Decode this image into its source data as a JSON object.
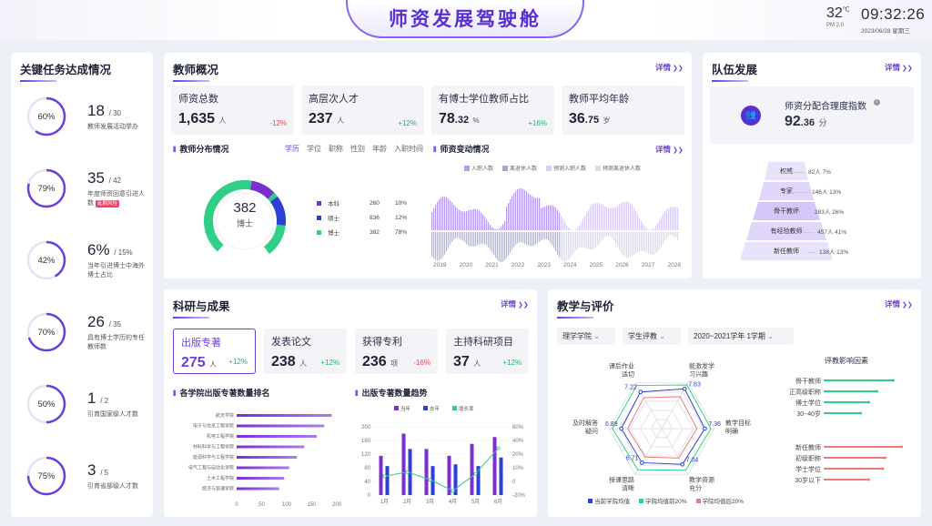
{
  "header": {
    "title": "师资发展驾驶舱",
    "temp": "32",
    "temp_unit": "℃",
    "pm": "PM 2.0",
    "time": "09:32:26",
    "date": "2023/06/28  星期三"
  },
  "left": {
    "title": "关键任务达成情况",
    "kpis": [
      {
        "pct": "60%",
        "pct_value": 0.6,
        "num": "18",
        "total": "/ 30",
        "desc": "教师发展活动举办",
        "badge": ""
      },
      {
        "pct": "79%",
        "pct_value": 0.79,
        "num": "35",
        "total": "/ 42",
        "desc": "年度师资回意引进人数",
        "badge": "延期风险"
      },
      {
        "pct": "42%",
        "pct_value": 0.42,
        "num": "6%",
        "total": "/ 15%",
        "desc": "当年引进博士中海外博士占比",
        "badge": ""
      },
      {
        "pct": "70%",
        "pct_value": 0.7,
        "num": "26",
        "total": "/ 35",
        "desc": "具有博士学历的专任教师数",
        "badge": ""
      },
      {
        "pct": "50%",
        "pct_value": 0.5,
        "num": "1",
        "total": "/ 2",
        "desc": "引育国家级人才数",
        "badge": ""
      },
      {
        "pct": "75%",
        "pct_value": 0.75,
        "num": "3",
        "total": "/ 5",
        "desc": "引育省部级人才数",
        "badge": ""
      }
    ]
  },
  "overview": {
    "title": "教师概况",
    "detail": "详情",
    "stats": [
      {
        "label": "师资总数",
        "value": "1,635",
        "small": "",
        "unit": "人",
        "change": "-12%",
        "dir": "down"
      },
      {
        "label": "高层次人才",
        "value": "237",
        "small": "",
        "unit": "人",
        "change": "+12%",
        "dir": "up"
      },
      {
        "label": "有博士学位教师占比",
        "value": "78",
        "small": ".32",
        "unit": "%",
        "change": "+16%",
        "dir": "up"
      },
      {
        "label": "教师平均年龄",
        "value": "36",
        "small": ".75",
        "unit": "岁",
        "change": "",
        "dir": ""
      }
    ],
    "dist": {
      "subtitle": "教师分布情况",
      "tabs": [
        "学历",
        "学位",
        "职称",
        "性别",
        "年龄",
        "入职时间"
      ],
      "center_value": "382",
      "center_label": "博士",
      "items": [
        {
          "name": "本科",
          "count": "260",
          "pct": "10%",
          "color": "#7b2fd0"
        },
        {
          "name": "硕士",
          "count": "836",
          "pct": "12%",
          "color": "#2e3fd6"
        },
        {
          "name": "博士",
          "count": "382",
          "pct": "78%",
          "color": "#2fcf86"
        }
      ]
    },
    "change": {
      "subtitle": "师资变动情况",
      "detail": "详情",
      "legend": [
        "入职人数",
        "离退休人数",
        "预测入职人数",
        "预测离退休人数"
      ],
      "years": [
        "2019",
        "2020",
        "2021",
        "2022",
        "2023",
        "2024",
        "2025",
        "2026",
        "2027",
        "2028"
      ]
    }
  },
  "team": {
    "title": "队伍发展",
    "detail": "详情",
    "index_label": "师资分配合理度指数",
    "index_value": "92",
    "index_small": ".36",
    "index_unit": "分",
    "levels": [
      {
        "name": "权威",
        "value": "82人  7%"
      },
      {
        "name": "专家",
        "value": "146人  13%"
      },
      {
        "name": "骨干教师",
        "value": "283人  26%"
      },
      {
        "name": "有经验教师",
        "value": "457人  41%"
      },
      {
        "name": "新任教师",
        "value": "138人  13%"
      }
    ]
  },
  "research": {
    "title": "科研与成果",
    "detail": "详情",
    "stats": [
      {
        "label": "出版专著",
        "value": "275",
        "unit": "人",
        "change": "+12%",
        "dir": "up"
      },
      {
        "label": "发表论文",
        "value": "238",
        "unit": "人",
        "change": "+12%",
        "dir": "up"
      },
      {
        "label": "获得专利",
        "value": "236",
        "unit": "项",
        "change": "-16%",
        "dir": "down"
      },
      {
        "label": "主持科研项目",
        "value": "37",
        "unit": "人",
        "change": "+12%",
        "dir": "up"
      }
    ],
    "rank_title": "各学院出版专著数量排名",
    "trend_title": "出版专著数量趋势"
  },
  "teaching": {
    "title": "教学与评价",
    "detail": "详情",
    "selects": [
      "理学学院",
      "学生评教",
      "2020~2021学年 1学期"
    ],
    "radar_labels": [
      "能激发学习兴趣",
      "教学目标明确",
      "教学资源充分",
      "授课思路清晰",
      "及时解答疑问",
      "课后作业适切"
    ],
    "factor_title": "评教影响因素",
    "pos_factors": [
      "骨干教师",
      "正高级职称",
      "博士学位",
      "30~40岁"
    ],
    "neg_factors": [
      "新任教师",
      "初级职称",
      "学士学位",
      "30岁以下"
    ],
    "legend": [
      "当前学院均值",
      "学院均值前20%",
      "学院均值后20%"
    ]
  },
  "chart_data": [
    {
      "type": "bar",
      "title": "各学院出版专著数量排名",
      "categories": [
        "航天学院",
        "电子与信息工程学院",
        "机电工程学院",
        "材料科学与工程学院",
        "能源科学与工程学院",
        "电气工程与自动化学院",
        "土木工程学院",
        "经济与管理学院"
      ],
      "values": [
        190,
        175,
        160,
        135,
        120,
        105,
        95,
        85
      ],
      "xlim": [
        0,
        200
      ],
      "xticks": [
        "0",
        "50",
        "100",
        "150",
        "200"
      ]
    },
    {
      "type": "bar",
      "title": "出版专著数量趋势",
      "categories": [
        "1月",
        "2月",
        "3月",
        "4月",
        "5月",
        "6月"
      ],
      "series": [
        {
          "name": "当年",
          "values": [
            115,
            180,
            135,
            115,
            150,
            170
          ],
          "color": "#7b2fd0"
        },
        {
          "name": "去年",
          "values": [
            85,
            135,
            85,
            90,
            85,
            110
          ],
          "color": "#2e3fd6"
        },
        {
          "name": "增长率",
          "values": [
            2,
            7,
            -2,
            -15,
            5,
            35
          ],
          "color": "#2fcf86"
        }
      ],
      "ylim": [
        0,
        200
      ],
      "yticks": [
        "0",
        "40",
        "80",
        "120",
        "160",
        "200"
      ],
      "y2ticks": [
        "-20%",
        "0",
        "10%",
        "20%",
        "40%",
        "60%"
      ]
    },
    {
      "type": "radar",
      "title": "教学与评价",
      "axes": [
        "能激发学习兴趣",
        "教学目标明确",
        "教学资源充分",
        "授课思路清晰",
        "及时解答疑问",
        "课后作业适切"
      ],
      "series": [
        {
          "name": "当前学院均值",
          "values": [
            7.83,
            7.36,
            7.04,
            6.71,
            6.89,
            7.22
          ],
          "color": "#2e3fd6"
        },
        {
          "name": "学院均值前20%",
          "values": [
            8.6,
            8.4,
            8.2,
            8.1,
            8.4,
            8.5
          ],
          "color": "#2fcf86"
        },
        {
          "name": "学院均值后20%",
          "values": [
            6.3,
            6.0,
            5.8,
            5.6,
            5.8,
            6.1
          ],
          "color": "#f07a7a"
        }
      ]
    },
    {
      "type": "bar",
      "title": "评教影响因素",
      "categories": [
        "骨干教师",
        "正高级职称",
        "博士学位",
        "30~40岁",
        "新任教师",
        "初级职称",
        "学士学位",
        "30岁以下"
      ],
      "values": [
        0.85,
        0.65,
        0.55,
        0.45,
        0.95,
        0.75,
        0.72,
        0.55
      ]
    }
  ]
}
